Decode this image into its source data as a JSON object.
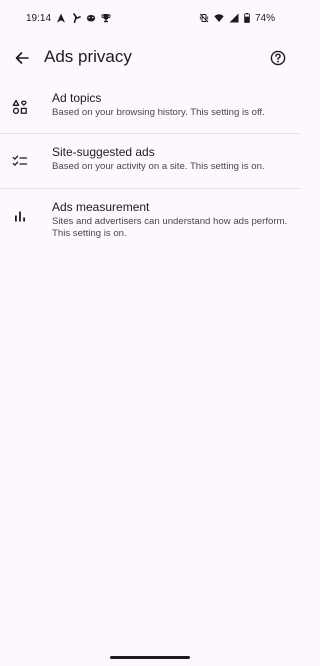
{
  "status_bar": {
    "time": "19:14",
    "battery": "74%",
    "left_icons": [
      "navigation-icon",
      "fan-icon",
      "game-controller-icon",
      "trophy-icon"
    ],
    "right_icons": [
      "mute-vibrate-icon",
      "wifi-icon",
      "signal-icon",
      "battery-icon"
    ]
  },
  "app_bar": {
    "title": "Ads privacy",
    "back_icon": "arrow-back-icon",
    "help_icon": "help-icon"
  },
  "items": [
    {
      "title": "Ad topics",
      "subtitle": "Based on your browsing history. This setting is off.",
      "icon": "shapes-icon"
    },
    {
      "title": "Site-suggested ads",
      "subtitle": "Based on your activity on a site. This setting is on.",
      "icon": "checklist-icon"
    },
    {
      "title": "Ads measurement",
      "subtitle": "Sites and advertisers can understand how ads perform. This setting is on.",
      "icon": "bar-chart-icon"
    }
  ],
  "colors": {
    "background": "#fdf8fd",
    "text_primary": "#1d1b20",
    "text_secondary": "#49454f",
    "divider": "#e7e0e8"
  }
}
